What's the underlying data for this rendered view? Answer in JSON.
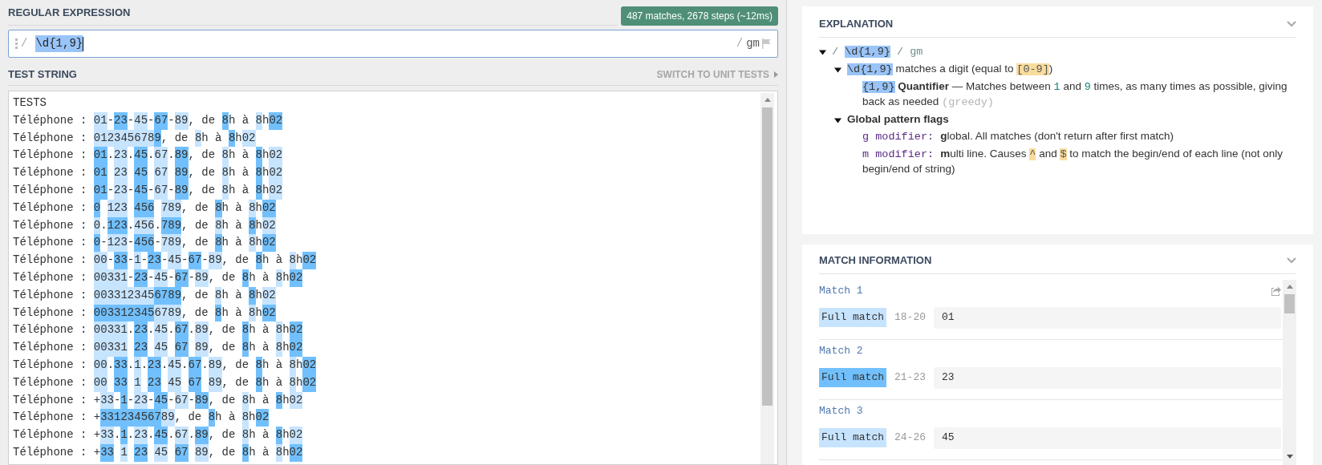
{
  "regex": {
    "title": "REGULAR EXPRESSION",
    "summary": "487 matches, 2678 steps (~12ms)",
    "open": "/",
    "pattern": "\\d{1,9}",
    "selected": true,
    "close": "/",
    "flags": "gm"
  },
  "test_string": {
    "title": "TEST STRING",
    "switch_label": "SWITCH TO UNIT TESTS",
    "lines": [
      {
        "segments": [
          {
            "kind": "plain",
            "text": "TESTS"
          }
        ]
      },
      {
        "segments": [
          {
            "kind": "plain",
            "text": "Téléphone : "
          },
          {
            "kind": "light_match",
            "text": "01"
          },
          {
            "kind": "plain",
            "text": "-"
          },
          {
            "kind": "dark_match",
            "text": "23"
          },
          {
            "kind": "plain",
            "text": "-"
          },
          {
            "kind": "light_match",
            "text": "45"
          },
          {
            "kind": "plain",
            "text": "-"
          },
          {
            "kind": "dark_match",
            "text": "67"
          },
          {
            "kind": "plain",
            "text": "-"
          },
          {
            "kind": "light_match",
            "text": "89"
          },
          {
            "kind": "plain",
            "text": ", de"
          },
          {
            "kind": "dark_match",
            "text": "8",
            "gap_before": true
          },
          {
            "kind": "plain",
            "text": "h à"
          },
          {
            "kind": "light_match",
            "text": "8",
            "gap_before": true
          },
          {
            "kind": "plain",
            "text": "h"
          },
          {
            "kind": "dark_match",
            "text": "02"
          }
        ]
      },
      {
        "segments": [
          {
            "kind": "plain",
            "text": "Téléphone : "
          },
          {
            "kind": "light_match",
            "text": "012345678"
          },
          {
            "kind": "dark_match",
            "text": "9"
          },
          {
            "kind": "plain",
            "text": ", de"
          },
          {
            "kind": "light_match",
            "text": "8",
            "gap_before": true
          },
          {
            "kind": "plain",
            "text": "h à"
          },
          {
            "kind": "dark_match",
            "text": "8",
            "gap_before": true
          },
          {
            "kind": "plain",
            "text": "h"
          },
          {
            "kind": "light_match",
            "text": "02"
          }
        ]
      },
      {
        "segments": [
          {
            "kind": "plain",
            "text": "Téléphone : "
          },
          {
            "kind": "dark_match",
            "text": "01"
          },
          {
            "kind": "plain",
            "text": "."
          },
          {
            "kind": "light_match",
            "text": "23"
          },
          {
            "kind": "plain",
            "text": "."
          },
          {
            "kind": "dark_match",
            "text": "45"
          },
          {
            "kind": "plain",
            "text": "."
          },
          {
            "kind": "light_match",
            "text": "67"
          },
          {
            "kind": "plain",
            "text": "."
          },
          {
            "kind": "dark_match",
            "text": "89"
          },
          {
            "kind": "plain",
            "text": ", de"
          },
          {
            "kind": "light_match",
            "text": "8",
            "gap_before": true
          },
          {
            "kind": "plain",
            "text": "h à"
          },
          {
            "kind": "dark_match",
            "text": "8",
            "gap_before": true
          },
          {
            "kind": "plain",
            "text": "h"
          },
          {
            "kind": "light_match",
            "text": "02"
          }
        ]
      },
      {
        "segments": [
          {
            "kind": "plain",
            "text": "Téléphone : "
          },
          {
            "kind": "dark_match",
            "text": "01"
          },
          {
            "kind": "light_match",
            "text": "23",
            "gap_before": true
          },
          {
            "kind": "dark_match",
            "text": "45",
            "gap_before": true
          },
          {
            "kind": "light_match",
            "text": "67",
            "gap_before": true
          },
          {
            "kind": "dark_match",
            "text": "89",
            "gap_before": true
          },
          {
            "kind": "plain",
            "text": ", de"
          },
          {
            "kind": "light_match",
            "text": "8",
            "gap_before": true
          },
          {
            "kind": "plain",
            "text": "h à"
          },
          {
            "kind": "dark_match",
            "text": "8",
            "gap_before": true
          },
          {
            "kind": "plain",
            "text": "h"
          },
          {
            "kind": "light_match",
            "text": "02"
          }
        ]
      },
      {
        "segments": [
          {
            "kind": "plain",
            "text": "Téléphone : "
          },
          {
            "kind": "dark_match",
            "text": "01"
          },
          {
            "kind": "plain",
            "text": "-"
          },
          {
            "kind": "light_match",
            "text": "23"
          },
          {
            "kind": "plain",
            "text": "-"
          },
          {
            "kind": "dark_match",
            "text": "45"
          },
          {
            "kind": "plain",
            "text": "-"
          },
          {
            "kind": "light_match",
            "text": "67"
          },
          {
            "kind": "plain",
            "text": "-"
          },
          {
            "kind": "dark_match",
            "text": "89"
          },
          {
            "kind": "plain",
            "text": ", de"
          },
          {
            "kind": "light_match",
            "text": "8",
            "gap_before": true
          },
          {
            "kind": "plain",
            "text": "h à"
          },
          {
            "kind": "dark_match",
            "text": "8",
            "gap_before": true
          },
          {
            "kind": "plain",
            "text": "h"
          },
          {
            "kind": "light_match",
            "text": "02"
          }
        ]
      },
      {
        "segments": [
          {
            "kind": "plain",
            "text": "Téléphone : "
          },
          {
            "kind": "dark_match",
            "text": "0"
          },
          {
            "kind": "light_match",
            "text": "123",
            "gap_before": true
          },
          {
            "kind": "dark_match",
            "text": "456",
            "gap_before": true
          },
          {
            "kind": "light_match",
            "text": "789",
            "gap_before": true
          },
          {
            "kind": "plain",
            "text": ", de"
          },
          {
            "kind": "dark_match",
            "text": "8",
            "gap_before": true
          },
          {
            "kind": "plain",
            "text": "h à"
          },
          {
            "kind": "light_match",
            "text": "8",
            "gap_before": true
          },
          {
            "kind": "plain",
            "text": "h"
          },
          {
            "kind": "dark_match",
            "text": "02"
          }
        ]
      },
      {
        "segments": [
          {
            "kind": "plain",
            "text": "Téléphone : "
          },
          {
            "kind": "light_match",
            "text": "0"
          },
          {
            "kind": "plain",
            "text": "."
          },
          {
            "kind": "dark_match",
            "text": "123"
          },
          {
            "kind": "plain",
            "text": "."
          },
          {
            "kind": "light_match",
            "text": "456"
          },
          {
            "kind": "plain",
            "text": "."
          },
          {
            "kind": "dark_match",
            "text": "789"
          },
          {
            "kind": "plain",
            "text": ", de"
          },
          {
            "kind": "light_match",
            "text": "8",
            "gap_before": true
          },
          {
            "kind": "plain",
            "text": "h à"
          },
          {
            "kind": "dark_match",
            "text": "8",
            "gap_before": true
          },
          {
            "kind": "plain",
            "text": "h"
          },
          {
            "kind": "light_match",
            "text": "02"
          }
        ]
      },
      {
        "segments": [
          {
            "kind": "plain",
            "text": "Téléphone : "
          },
          {
            "kind": "dark_match",
            "text": "0"
          },
          {
            "kind": "plain",
            "text": "-"
          },
          {
            "kind": "light_match",
            "text": "123"
          },
          {
            "kind": "plain",
            "text": "-"
          },
          {
            "kind": "dark_match",
            "text": "456"
          },
          {
            "kind": "plain",
            "text": "-"
          },
          {
            "kind": "light_match",
            "text": "789"
          },
          {
            "kind": "plain",
            "text": ", de"
          },
          {
            "kind": "dark_match",
            "text": "8",
            "gap_before": true
          },
          {
            "kind": "plain",
            "text": "h à"
          },
          {
            "kind": "light_match",
            "text": "8",
            "gap_before": true
          },
          {
            "kind": "plain",
            "text": "h"
          },
          {
            "kind": "dark_match",
            "text": "02"
          }
        ]
      },
      {
        "segments": [
          {
            "kind": "plain",
            "text": "Téléphone : "
          },
          {
            "kind": "light_match",
            "text": "00"
          },
          {
            "kind": "plain",
            "text": "-"
          },
          {
            "kind": "dark_match",
            "text": "33"
          },
          {
            "kind": "plain",
            "text": "-"
          },
          {
            "kind": "light_match",
            "text": "1"
          },
          {
            "kind": "plain",
            "text": "-"
          },
          {
            "kind": "dark_match",
            "text": "23"
          },
          {
            "kind": "plain",
            "text": "-"
          },
          {
            "kind": "light_match",
            "text": "45"
          },
          {
            "kind": "plain",
            "text": "-"
          },
          {
            "kind": "dark_match",
            "text": "67"
          },
          {
            "kind": "plain",
            "text": "-"
          },
          {
            "kind": "light_match",
            "text": "89"
          },
          {
            "kind": "plain",
            "text": ", de"
          },
          {
            "kind": "dark_match",
            "text": "8",
            "gap_before": true
          },
          {
            "kind": "plain",
            "text": "h à"
          },
          {
            "kind": "light_match",
            "text": "8",
            "gap_before": true
          },
          {
            "kind": "plain",
            "text": "h"
          },
          {
            "kind": "dark_match",
            "text": "02"
          }
        ]
      },
      {
        "segments": [
          {
            "kind": "plain",
            "text": "Téléphone : "
          },
          {
            "kind": "light_match",
            "text": "00331"
          },
          {
            "kind": "plain",
            "text": "-"
          },
          {
            "kind": "dark_match",
            "text": "23"
          },
          {
            "kind": "plain",
            "text": "-"
          },
          {
            "kind": "light_match",
            "text": "45"
          },
          {
            "kind": "plain",
            "text": "-"
          },
          {
            "kind": "dark_match",
            "text": "67"
          },
          {
            "kind": "plain",
            "text": "-"
          },
          {
            "kind": "light_match",
            "text": "89"
          },
          {
            "kind": "plain",
            "text": ", de"
          },
          {
            "kind": "dark_match",
            "text": "8",
            "gap_before": true
          },
          {
            "kind": "plain",
            "text": "h à"
          },
          {
            "kind": "light_match",
            "text": "8",
            "gap_before": true
          },
          {
            "kind": "plain",
            "text": "h"
          },
          {
            "kind": "dark_match",
            "text": "02"
          }
        ]
      },
      {
        "segments": [
          {
            "kind": "plain",
            "text": "Téléphone : "
          },
          {
            "kind": "light_match",
            "text": "003312345"
          },
          {
            "kind": "dark_match",
            "text": "6789"
          },
          {
            "kind": "plain",
            "text": ", de"
          },
          {
            "kind": "light_match",
            "text": "8",
            "gap_before": true
          },
          {
            "kind": "plain",
            "text": "h à"
          },
          {
            "kind": "dark_match",
            "text": "8",
            "gap_before": true
          },
          {
            "kind": "plain",
            "text": "h"
          },
          {
            "kind": "light_match",
            "text": "02"
          }
        ]
      },
      {
        "segments": [
          {
            "kind": "plain",
            "text": "Téléphone : "
          },
          {
            "kind": "dark_match",
            "text": "003312345"
          },
          {
            "kind": "light_match",
            "text": "6789"
          },
          {
            "kind": "plain",
            "text": ", de"
          },
          {
            "kind": "dark_match",
            "text": "8",
            "gap_before": true
          },
          {
            "kind": "plain",
            "text": "h à"
          },
          {
            "kind": "light_match",
            "text": "8",
            "gap_before": true
          },
          {
            "kind": "plain",
            "text": "h"
          },
          {
            "kind": "dark_match",
            "text": "02"
          }
        ]
      },
      {
        "segments": [
          {
            "kind": "plain",
            "text": "Téléphone : "
          },
          {
            "kind": "light_match",
            "text": "00331"
          },
          {
            "kind": "plain",
            "text": "."
          },
          {
            "kind": "dark_match",
            "text": "23"
          },
          {
            "kind": "plain",
            "text": "."
          },
          {
            "kind": "light_match",
            "text": "45"
          },
          {
            "kind": "plain",
            "text": "."
          },
          {
            "kind": "dark_match",
            "text": "67"
          },
          {
            "kind": "plain",
            "text": "."
          },
          {
            "kind": "light_match",
            "text": "89"
          },
          {
            "kind": "plain",
            "text": ", de"
          },
          {
            "kind": "dark_match",
            "text": "8",
            "gap_before": true
          },
          {
            "kind": "plain",
            "text": "h à"
          },
          {
            "kind": "light_match",
            "text": "8",
            "gap_before": true
          },
          {
            "kind": "plain",
            "text": "h"
          },
          {
            "kind": "dark_match",
            "text": "02"
          }
        ]
      },
      {
        "segments": [
          {
            "kind": "plain",
            "text": "Téléphone : "
          },
          {
            "kind": "light_match",
            "text": "00331"
          },
          {
            "kind": "dark_match",
            "text": "23",
            "gap_before": true
          },
          {
            "kind": "light_match",
            "text": "45",
            "gap_before": true
          },
          {
            "kind": "dark_match",
            "text": "67",
            "gap_before": true
          },
          {
            "kind": "light_match",
            "text": "89",
            "gap_before": true
          },
          {
            "kind": "plain",
            "text": ", de"
          },
          {
            "kind": "dark_match",
            "text": "8",
            "gap_before": true
          },
          {
            "kind": "plain",
            "text": "h à"
          },
          {
            "kind": "light_match",
            "text": "8",
            "gap_before": true
          },
          {
            "kind": "plain",
            "text": "h"
          },
          {
            "kind": "dark_match",
            "text": "02"
          }
        ]
      },
      {
        "segments": [
          {
            "kind": "plain",
            "text": "Téléphone : "
          },
          {
            "kind": "light_match",
            "text": "00"
          },
          {
            "kind": "plain",
            "text": "."
          },
          {
            "kind": "dark_match",
            "text": "33"
          },
          {
            "kind": "plain",
            "text": "."
          },
          {
            "kind": "light_match",
            "text": "1"
          },
          {
            "kind": "plain",
            "text": "."
          },
          {
            "kind": "dark_match",
            "text": "23"
          },
          {
            "kind": "plain",
            "text": "."
          },
          {
            "kind": "light_match",
            "text": "45"
          },
          {
            "kind": "plain",
            "text": "."
          },
          {
            "kind": "dark_match",
            "text": "67"
          },
          {
            "kind": "plain",
            "text": "."
          },
          {
            "kind": "light_match",
            "text": "89"
          },
          {
            "kind": "plain",
            "text": ", de"
          },
          {
            "kind": "dark_match",
            "text": "8",
            "gap_before": true
          },
          {
            "kind": "plain",
            "text": "h à"
          },
          {
            "kind": "light_match",
            "text": "8",
            "gap_before": true
          },
          {
            "kind": "plain",
            "text": "h"
          },
          {
            "kind": "dark_match",
            "text": "02"
          }
        ]
      },
      {
        "segments": [
          {
            "kind": "plain",
            "text": "Téléphone : "
          },
          {
            "kind": "light_match",
            "text": "00"
          },
          {
            "kind": "dark_match",
            "text": "33",
            "gap_before": true
          },
          {
            "kind": "light_match",
            "text": "1",
            "gap_before": true
          },
          {
            "kind": "dark_match",
            "text": "23",
            "gap_before": true
          },
          {
            "kind": "light_match",
            "text": "45",
            "gap_before": true
          },
          {
            "kind": "dark_match",
            "text": "67",
            "gap_before": true
          },
          {
            "kind": "light_match",
            "text": "89",
            "gap_before": true
          },
          {
            "kind": "plain",
            "text": ", de"
          },
          {
            "kind": "dark_match",
            "text": "8",
            "gap_before": true
          },
          {
            "kind": "plain",
            "text": "h à"
          },
          {
            "kind": "light_match",
            "text": "8",
            "gap_before": true
          },
          {
            "kind": "plain",
            "text": "h"
          },
          {
            "kind": "dark_match",
            "text": "02"
          }
        ]
      },
      {
        "segments": [
          {
            "kind": "plain",
            "text": "Téléphone : +"
          },
          {
            "kind": "light_match",
            "text": "33"
          },
          {
            "kind": "plain",
            "text": "-"
          },
          {
            "kind": "dark_match",
            "text": "1"
          },
          {
            "kind": "plain",
            "text": "-"
          },
          {
            "kind": "light_match",
            "text": "23"
          },
          {
            "kind": "plain",
            "text": "-"
          },
          {
            "kind": "dark_match",
            "text": "45"
          },
          {
            "kind": "plain",
            "text": "-"
          },
          {
            "kind": "light_match",
            "text": "67"
          },
          {
            "kind": "plain",
            "text": "-"
          },
          {
            "kind": "dark_match",
            "text": "89"
          },
          {
            "kind": "plain",
            "text": ", de"
          },
          {
            "kind": "light_match",
            "text": "8",
            "gap_before": true
          },
          {
            "kind": "plain",
            "text": "h à"
          },
          {
            "kind": "dark_match",
            "text": "8",
            "gap_before": true
          },
          {
            "kind": "plain",
            "text": "h"
          },
          {
            "kind": "light_match",
            "text": "02"
          }
        ]
      },
      {
        "segments": [
          {
            "kind": "plain",
            "text": "Téléphone : +"
          },
          {
            "kind": "dark_match",
            "text": "331234567"
          },
          {
            "kind": "light_match",
            "text": "89"
          },
          {
            "kind": "plain",
            "text": ", de"
          },
          {
            "kind": "dark_match",
            "text": "8",
            "gap_before": true
          },
          {
            "kind": "plain",
            "text": "h à"
          },
          {
            "kind": "light_match",
            "text": "8",
            "gap_before": true
          },
          {
            "kind": "plain",
            "text": "h"
          },
          {
            "kind": "dark_match",
            "text": "02"
          }
        ]
      },
      {
        "segments": [
          {
            "kind": "plain",
            "text": "Téléphone : +"
          },
          {
            "kind": "light_match",
            "text": "33"
          },
          {
            "kind": "plain",
            "text": "."
          },
          {
            "kind": "dark_match",
            "text": "1"
          },
          {
            "kind": "plain",
            "text": "."
          },
          {
            "kind": "light_match",
            "text": "23"
          },
          {
            "kind": "plain",
            "text": "."
          },
          {
            "kind": "dark_match",
            "text": "45"
          },
          {
            "kind": "plain",
            "text": "."
          },
          {
            "kind": "light_match",
            "text": "67"
          },
          {
            "kind": "plain",
            "text": "."
          },
          {
            "kind": "dark_match",
            "text": "89"
          },
          {
            "kind": "plain",
            "text": ", de"
          },
          {
            "kind": "light_match",
            "text": "8",
            "gap_before": true
          },
          {
            "kind": "plain",
            "text": "h à"
          },
          {
            "kind": "dark_match",
            "text": "8",
            "gap_before": true
          },
          {
            "kind": "plain",
            "text": "h"
          },
          {
            "kind": "light_match",
            "text": "02"
          }
        ]
      },
      {
        "segments": [
          {
            "kind": "plain",
            "text": "Téléphone : +"
          },
          {
            "kind": "dark_match",
            "text": "33"
          },
          {
            "kind": "light_match",
            "text": "1",
            "gap_before": true
          },
          {
            "kind": "dark_match",
            "text": "23",
            "gap_before": true
          },
          {
            "kind": "light_match",
            "text": "45",
            "gap_before": true
          },
          {
            "kind": "dark_match",
            "text": "67",
            "gap_before": true
          },
          {
            "kind": "light_match",
            "text": "89",
            "gap_before": true
          },
          {
            "kind": "plain",
            "text": ", de"
          },
          {
            "kind": "dark_match",
            "text": "8",
            "gap_before": true
          },
          {
            "kind": "plain",
            "text": "h à"
          },
          {
            "kind": "light_match",
            "text": "8",
            "gap_before": true
          },
          {
            "kind": "plain",
            "text": "h"
          },
          {
            "kind": "dark_match",
            "text": "02"
          }
        ]
      }
    ]
  },
  "explanation": {
    "title": "EXPLANATION",
    "tree": [
      {
        "expanded": true,
        "segments": [
          {
            "text": "/ ",
            "kind": "delimiter"
          },
          {
            "text": "\\d{1,9}",
            "kind": "token"
          },
          {
            "text": " / gm",
            "kind": "delimiter"
          }
        ],
        "children": [
          {
            "expanded": true,
            "segments": [
              {
                "text": "\\d{1,9}",
                "kind": "token"
              },
              {
                "text": " matches a digit (equal to ",
                "kind": "plain"
              },
              {
                "text": "[0-9]",
                "kind": "class"
              },
              {
                "text": ")",
                "kind": "plain"
              }
            ],
            "children": [
              {
                "segments": [
                  {
                    "text": "{1,9}",
                    "kind": "token"
                  },
                  {
                    "text": " Quantifier",
                    "kind": "bold"
                  },
                  {
                    "text": " — Matches between ",
                    "kind": "plain"
                  },
                  {
                    "text": "1",
                    "kind": "number"
                  },
                  {
                    "text": " and ",
                    "kind": "plain"
                  },
                  {
                    "text": "9",
                    "kind": "number"
                  },
                  {
                    "text": " times, as many times as possible, giving back as needed ",
                    "kind": "plain"
                  },
                  {
                    "text": "(greedy)",
                    "kind": "hint"
                  }
                ]
              }
            ]
          },
          {
            "expanded": true,
            "segments": [
              {
                "text": "Global pattern flags",
                "kind": "bold"
              }
            ],
            "children": [
              {
                "segments": [
                  {
                    "text": "g modifier: ",
                    "kind": "flag"
                  },
                  {
                    "text": "g",
                    "kind": "bold"
                  },
                  {
                    "text": "lobal. All matches (don't return after first match)",
                    "kind": "plain"
                  }
                ]
              },
              {
                "segments": [
                  {
                    "text": "m modifier: ",
                    "kind": "flag"
                  },
                  {
                    "text": "m",
                    "kind": "bold"
                  },
                  {
                    "text": "ulti line. Causes ",
                    "kind": "plain"
                  },
                  {
                    "text": "^",
                    "kind": "class"
                  },
                  {
                    "text": " and ",
                    "kind": "plain"
                  },
                  {
                    "text": "$",
                    "kind": "class"
                  },
                  {
                    "text": " to match the begin/end of each line (not only begin/end of string)",
                    "kind": "plain"
                  }
                ]
              }
            ]
          }
        ]
      }
    ]
  },
  "match_information": {
    "title": "MATCH INFORMATION",
    "matches": [
      {
        "title": "Match 1",
        "share_icon": true,
        "label": "Full match",
        "kind": "light_match",
        "range": "18-20",
        "value": "01"
      },
      {
        "title": "Match 2",
        "share_icon": false,
        "label": "Full match",
        "kind": "dark_match",
        "range": "21-23",
        "value": "23"
      },
      {
        "title": "Match 3",
        "share_icon": false,
        "label": "Full match",
        "kind": "light_match",
        "range": "24-26",
        "value": "45"
      }
    ]
  }
}
